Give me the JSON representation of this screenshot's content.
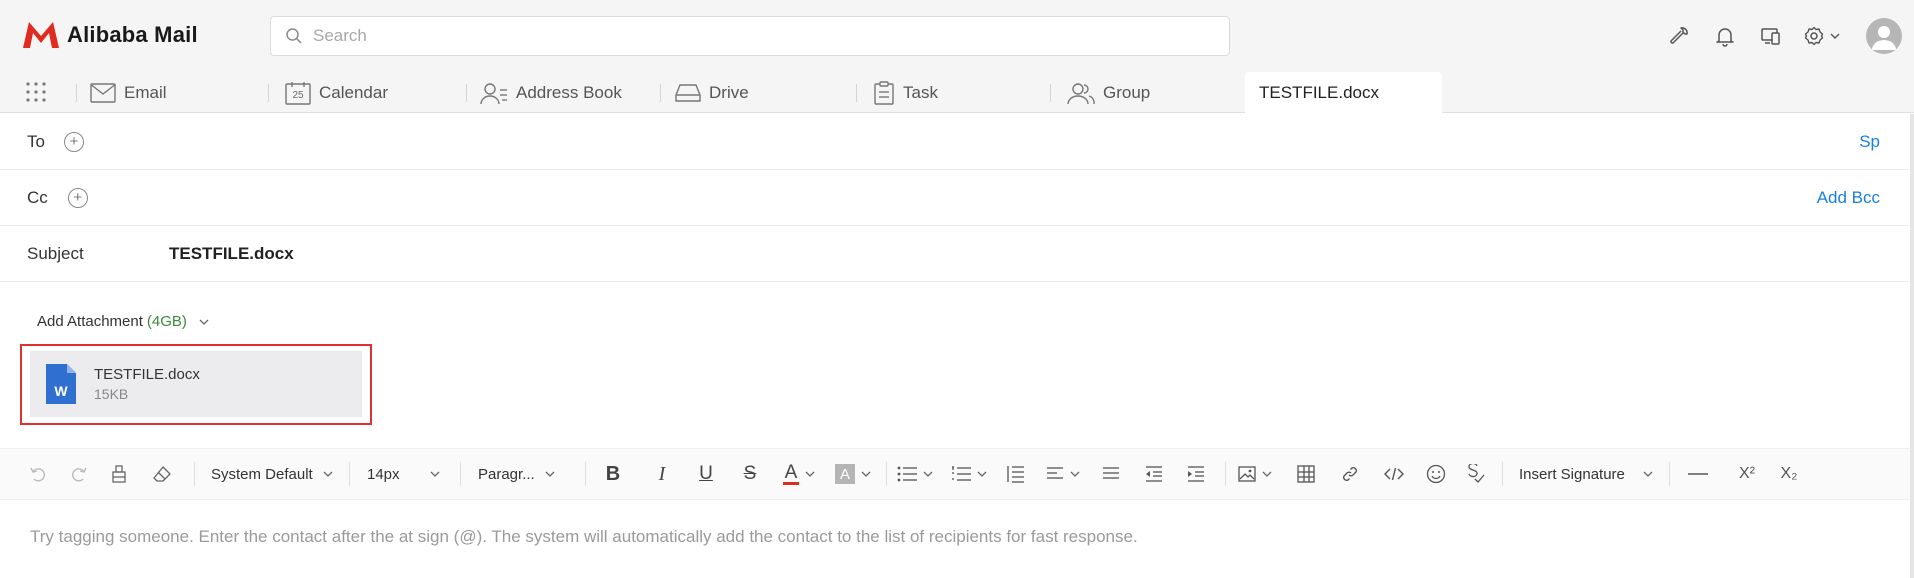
{
  "brand": {
    "name": "Alibaba Mail",
    "color": "#e02b20"
  },
  "search": {
    "placeholder": "Search"
  },
  "header_icons": [
    "wrench-icon",
    "bell-icon",
    "devices-icon",
    "gear-icon",
    "chevron-down-icon",
    "avatar"
  ],
  "nav": {
    "items": [
      {
        "label": "Email",
        "icon": "mail-icon"
      },
      {
        "label": "Calendar",
        "icon": "calendar-icon",
        "icon_text": "25"
      },
      {
        "label": "Address Book",
        "icon": "contacts-icon"
      },
      {
        "label": "Drive",
        "icon": "drive-icon"
      },
      {
        "label": "Task",
        "icon": "clipboard-icon"
      },
      {
        "label": "Group",
        "icon": "group-icon"
      }
    ],
    "active_tab": "TESTFILE.docx"
  },
  "compose": {
    "to_label": "To",
    "to_right": "Sp",
    "cc_label": "Cc",
    "cc_right": "Add Bcc",
    "subject_label": "Subject",
    "subject_value": "TESTFILE.docx",
    "attach_label": "Add Attachment",
    "attach_size": "(4GB)",
    "attachment": {
      "name": "TESTFILE.docx",
      "size": "15KB",
      "icon": "word-file-icon",
      "icon_text": "W"
    }
  },
  "toolbar": {
    "font_family": "System Default",
    "font_size": "14px",
    "block_format": "Paragr...",
    "signature": "Insert Signature",
    "color_letter": "A",
    "highlight_letter": "A",
    "bold": "B",
    "italic": "I",
    "underline": "U",
    "strike": "S",
    "superscript": "X²",
    "subscript": "X₂",
    "accent_red": "#e02b20"
  },
  "body": {
    "hint": "Try tagging someone. Enter the contact after the at sign (@). The system will automatically add the contact to the list of recipients for fast response."
  },
  "colors": {
    "link": "#1a7ee6",
    "highlight_box": "#e03030",
    "size_green": "#3a8a3a"
  }
}
